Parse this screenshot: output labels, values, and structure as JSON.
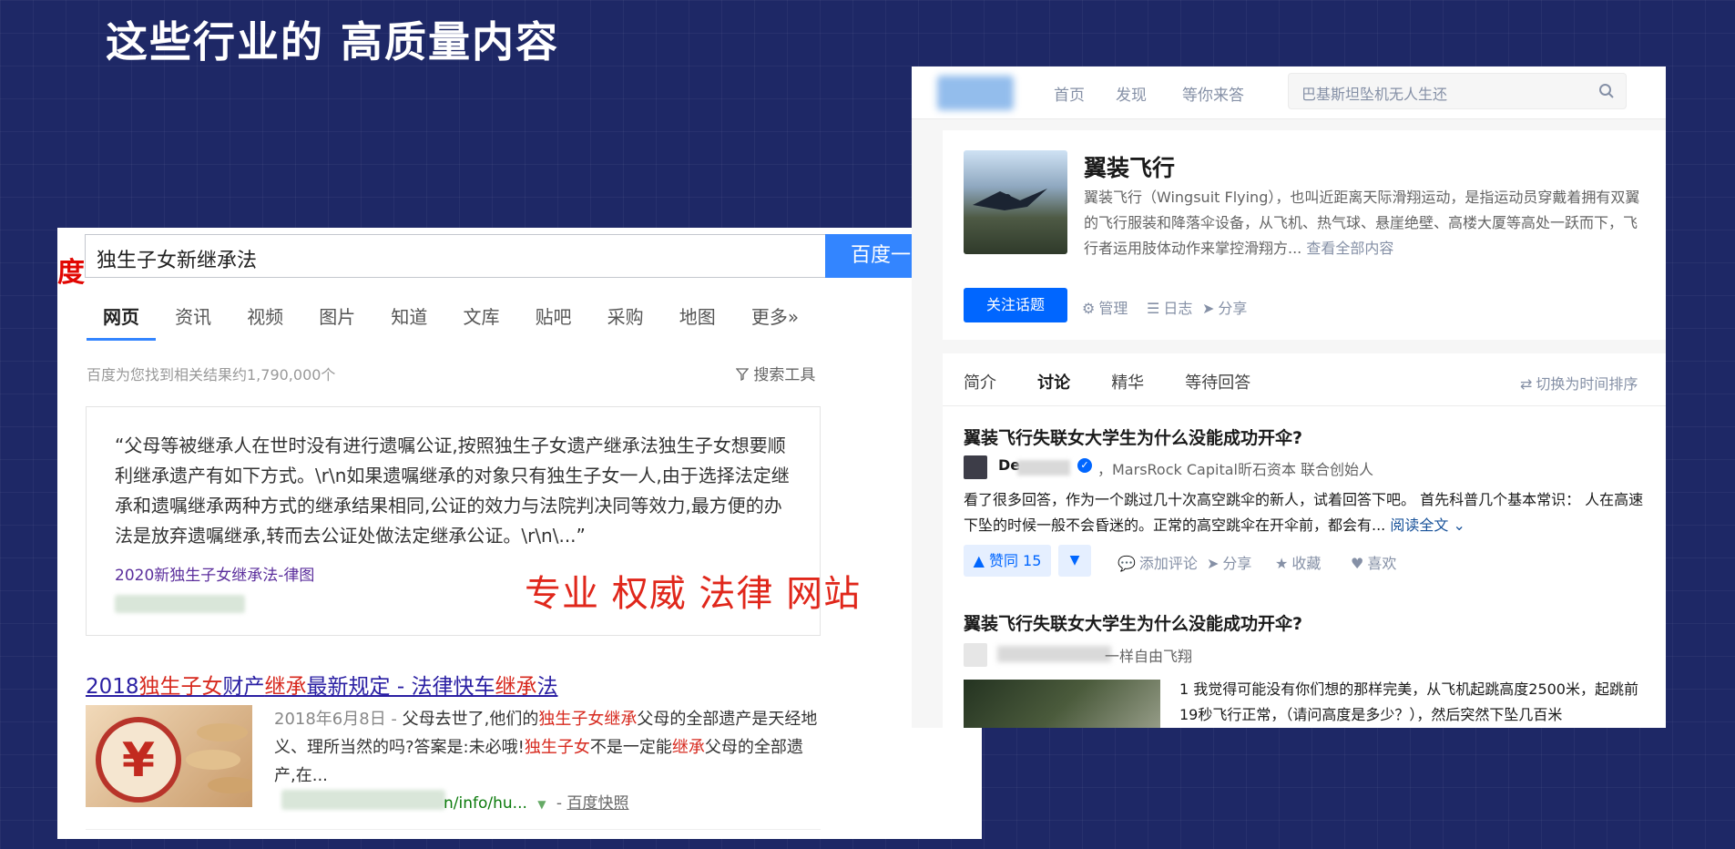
{
  "slide": {
    "title": "这些行业的 高质量内容"
  },
  "baidu": {
    "logo_fragment": "度",
    "search_value": "独生子女新继承法",
    "search_button": "百度一",
    "tabs": [
      "网页",
      "资讯",
      "视频",
      "图片",
      "知道",
      "文库",
      "贴吧",
      "采购",
      "地图",
      "更多»"
    ],
    "result_count": "百度为您找到相关结果约1,790,000个",
    "search_tools": "搜索工具",
    "card_quote": "“父母等被继承人在世时没有进行遗嘱公证,按照独生子女遗产继承法独生子女想要顺利继承遗产有如下方式。\\r\\n如果遗嘱继承的对象只有独生子女一人,由于选择法定继承和遗嘱继承两种方式的继承结果相同,公证的效力与法院判决同等效力,最方便的办法是放弃遗嘱继承,转而去公证处做法定继承公证。\\r\\n\\...”",
    "card_link": "2020新独生子女继承法-律图",
    "overlay_text": "专业 权威 法律 网站",
    "result_title_parts": [
      "2018",
      "独生子女",
      "财产",
      "继承",
      "最新",
      "规定 - 法律快车",
      "继承",
      "法"
    ],
    "snippet_date": "2018年6月8日 -",
    "snippet_parts": [
      " 父母去世了,他们的",
      "独生子女继承",
      "父母的全部遗产是天经地义、理所当然的吗?答案是:未必哦!",
      "独生子女",
      "不是一定能",
      "继承",
      "父母的全部遗产,在..."
    ],
    "url_tail": "n/info/hu...",
    "kuaizhao": "百度快照"
  },
  "zhihu": {
    "nav": [
      "首页",
      "发现",
      "等你来答"
    ],
    "search_placeholder": "巴基斯坦坠机无人生还",
    "topic": {
      "title": "翼装飞行",
      "desc": "翼装飞行（Wingsuit Flying），也叫近距离天际滑翔运动，是指运动员穿戴着拥有双翼的飞行服装和降落伞设备，从飞机、热气球、悬崖绝壁、高楼大厦等高处一跃而下，飞行者运用肢体动作来掌控滑翔方...",
      "more": "查看全部内容",
      "follow": "关注话题",
      "actions": [
        "管理",
        "日志",
        "分享"
      ]
    },
    "feed": {
      "tabs": [
        "简介",
        "讨论",
        "精华",
        "等待回答"
      ],
      "sort": "切换为时间排序",
      "q1": {
        "title": "翼装飞行失联女大学生为什么没能成功开伞?",
        "author_visible": "De",
        "bio": "，MarsRock Capital昕石资本 联合创始人",
        "excerpt": "看了很多回答，作为一个跳过几十次高空跳伞的新人，试着回答下吧。 首先科普几个基本常识： 人在高速下坠的时候一般不会昏迷的。正常的高空跳伞在开伞前，都会有...",
        "read_more": "阅读全文",
        "vote": "赞同 15",
        "actions": [
          "添加评论",
          "分享",
          "收藏",
          "喜欢"
        ]
      },
      "q2": {
        "title": "翼装飞行失联女大学生为什么没能成功开伞?",
        "bio": "一样自由飞翔",
        "excerpt": "1 我觉得可能没有你们想的那样完美，从飞机起跳高度2500米，起跳前19秒飞行正常，（请问高度是多少？），然后突然下坠几百米"
      }
    }
  },
  "colors": {
    "background": "#1e2866",
    "baidu_blue": "#3385ff",
    "baidu_red": "#d7291e",
    "zhihu_blue": "#0066ff",
    "overlay_red": "#e0271b"
  }
}
